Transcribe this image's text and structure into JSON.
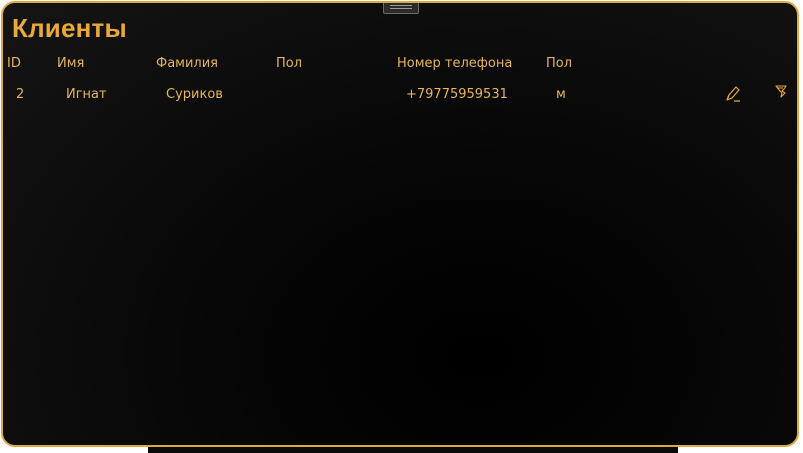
{
  "window": {
    "title": "Клиенты"
  },
  "table": {
    "columns": [
      "ID",
      "Имя",
      "Фамилия",
      "Пол",
      "Номер телефона",
      "Пол"
    ],
    "rows": [
      {
        "id": "2",
        "first_name": "Игнат",
        "last_name": "Суриков",
        "gender_1": "",
        "phone": "+79775959531",
        "gender_2": "м",
        "actions": [
          "edit-icon",
          "delete-icon"
        ]
      }
    ]
  },
  "colors": {
    "accent": "#e8a93a",
    "border": "#e0a93d",
    "background": "#000000"
  }
}
